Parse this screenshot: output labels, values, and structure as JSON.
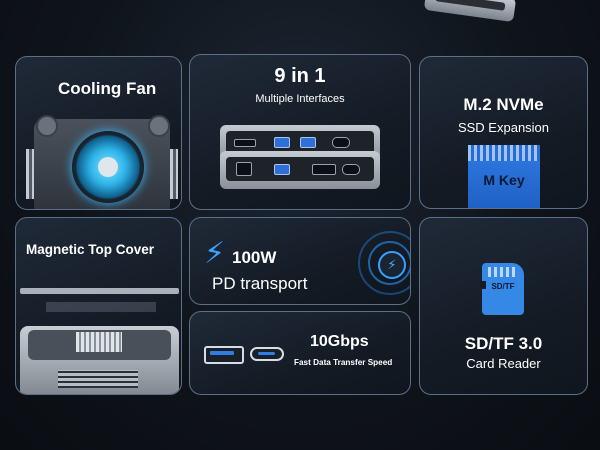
{
  "cards": {
    "cooling_fan": {
      "title": "Cooling Fan"
    },
    "hub": {
      "title": "9 in 1",
      "subtitle": "Multiple Interfaces"
    },
    "nvme": {
      "title": "M.2 NVMe",
      "subtitle": "SSD Expansion",
      "key_label": "M Key"
    },
    "magnetic": {
      "title": "Magnetic Top Cover"
    },
    "pd": {
      "title": "100W",
      "subtitle": "PD transport",
      "icon": "lightning-icon"
    },
    "usb": {
      "title": "10Gbps",
      "subtitle": "Fast Data Transfer Speed"
    },
    "sd": {
      "title": "SD/TF 3.0",
      "subtitle": "Card Reader",
      "icon_label": "SD/TF"
    }
  },
  "colors": {
    "accent": "#2f7de6",
    "border": "#5a6f88",
    "background": "#0f141b"
  }
}
